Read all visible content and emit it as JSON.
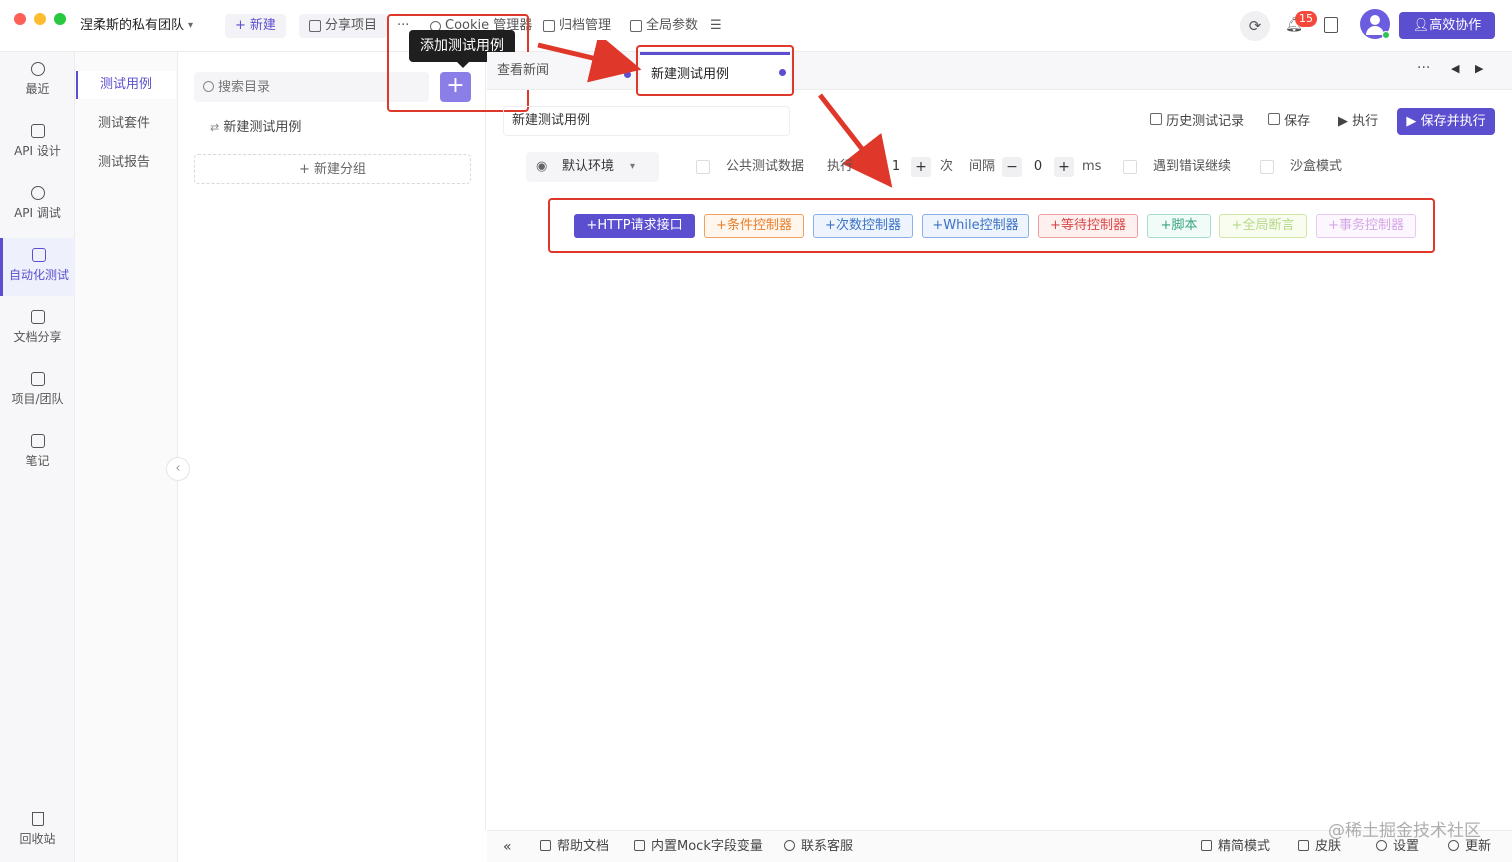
{
  "colors": {
    "accent": "#5b4fcf",
    "highlight": "#e0372b"
  },
  "titlebar": {
    "team": "涅柔斯的私有团队",
    "new_label": "新建",
    "share_label": "分享项目",
    "more": "···",
    "cookie_label": "Cookie 管理器",
    "archive_label": "归档管理",
    "global_params_label": "全局参数",
    "notification_count": "15",
    "collab_label": "高效协作"
  },
  "rail": {
    "items": [
      {
        "label": "最近",
        "icon": "clock-icon"
      },
      {
        "label": "API 设计",
        "icon": "edit-icon"
      },
      {
        "label": "API 调试",
        "icon": "rocket-icon"
      },
      {
        "label": "自动化测试",
        "icon": "flow-icon"
      },
      {
        "label": "文档分享",
        "icon": "doc-icon"
      },
      {
        "label": "项目/团队",
        "icon": "folder-icon"
      },
      {
        "label": "笔记",
        "icon": "note-icon"
      }
    ],
    "trash_label": "回收站"
  },
  "subnav": {
    "items": [
      "测试用例",
      "测试套件",
      "测试报告"
    ]
  },
  "tree": {
    "search_placeholder": "搜索目录",
    "add_tooltip": "添加测试用例",
    "case_item": "新建测试用例",
    "new_group": "新建分组"
  },
  "tabs": {
    "first": "查看新闻",
    "active": "新建测试用例"
  },
  "editor": {
    "case_name": "新建测试用例",
    "history_label": "历史测试记录",
    "save_label": "保存",
    "run_label": "执行",
    "save_run_label": "保存并执行",
    "env_label": "默认环境",
    "public_data_label": "公共测试数据",
    "exec_label": "执行",
    "exec_count": "1",
    "times_label": "次",
    "interval_label": "间隔",
    "interval_value": "0",
    "ms_label": "ms",
    "continue_on_error_label": "遇到错误继续",
    "sandbox_label": "沙盒模式"
  },
  "controllers": [
    {
      "label": "HTTP请求接口",
      "color": "#5b4fcf",
      "bg": "#5b4fcf",
      "text": "#ffffff"
    },
    {
      "label": "条件控制器",
      "color": "#f0a060",
      "bg": "#fff6ee",
      "text": "#e8802f"
    },
    {
      "label": "次数控制器",
      "color": "#8ab0e6",
      "bg": "#eef4fd",
      "text": "#3b72c4"
    },
    {
      "label": "While控制器",
      "color": "#8ab0e6",
      "bg": "#eef4fd",
      "text": "#3b72c4"
    },
    {
      "label": "等待控制器",
      "color": "#f0a0a0",
      "bg": "#fff0f0",
      "text": "#d94848"
    },
    {
      "label": "脚本",
      "color": "#a8dcc8",
      "bg": "#f1fbf7",
      "text": "#3aa57f"
    },
    {
      "label": "全局断言",
      "color": "#cfe8a8",
      "bg": "#f8fdf0",
      "text": "#b7d98a"
    },
    {
      "label": "事务控制器",
      "color": "#e8c8f0",
      "bg": "#fcf6fe",
      "text": "#d4a8e6"
    }
  ],
  "footer": {
    "collapse": "«",
    "help_label": "帮助文档",
    "mock_label": "内置Mock字段变量",
    "support_label": "联系客服",
    "compact_label": "精简模式",
    "skin_label": "皮肤",
    "settings_label": "设置",
    "update_label": "更新"
  },
  "watermark": "@稀土掘金技术社区"
}
